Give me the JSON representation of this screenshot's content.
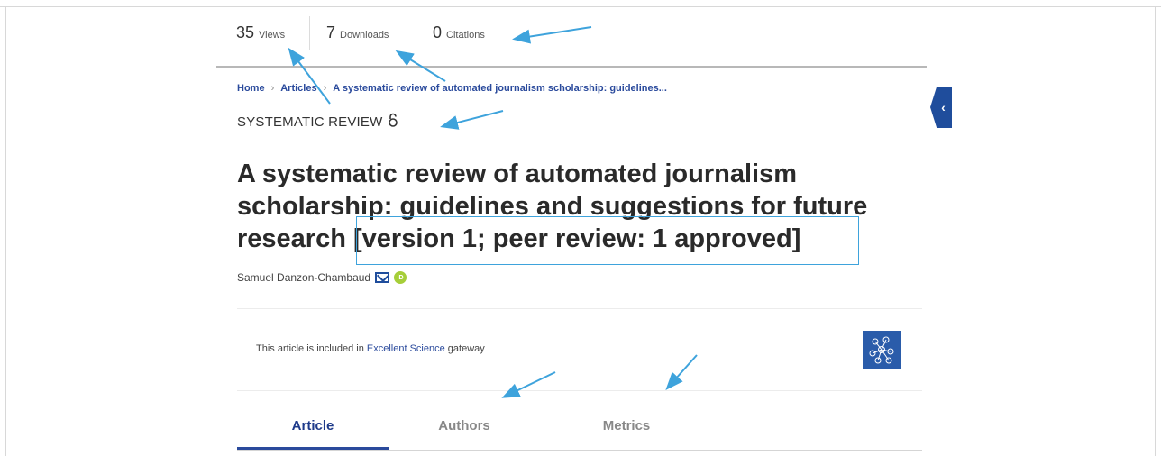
{
  "metrics": [
    {
      "value": "35",
      "label": "Views"
    },
    {
      "value": "7",
      "label": "Downloads"
    },
    {
      "value": "0",
      "label": "Citations"
    }
  ],
  "breadcrumb": {
    "home": "Home",
    "articles": "Articles",
    "current": "A systematic review of automated journalism scholarship: guidelines...",
    "separator": "›"
  },
  "article": {
    "type": "SYSTEMATIC REVIEW",
    "title_main": "A systematic review of automated journalism scholarship: guidelines and suggestions for future research",
    "title_version": "[version 1; peer review: 1 approved]",
    "author": "Samuel Danzon-Chambaud"
  },
  "gateway": {
    "prefix": "This article is included in",
    "link": "Excellent Science",
    "suffix": "gateway"
  },
  "tabs": [
    {
      "label": "Article",
      "active": true
    },
    {
      "label": "Authors",
      "active": false
    },
    {
      "label": "Metrics",
      "active": false
    }
  ],
  "icons": {
    "open_access": "open-lock-icon",
    "mail": "mail-icon",
    "orcid": "orcid-icon",
    "side_toggle": "chevron-left-icon"
  },
  "colors": {
    "accent": "#1e3a8a",
    "link": "#2a4a9c",
    "annotation": "#3ea3dc",
    "orcid": "#a6ce39"
  }
}
